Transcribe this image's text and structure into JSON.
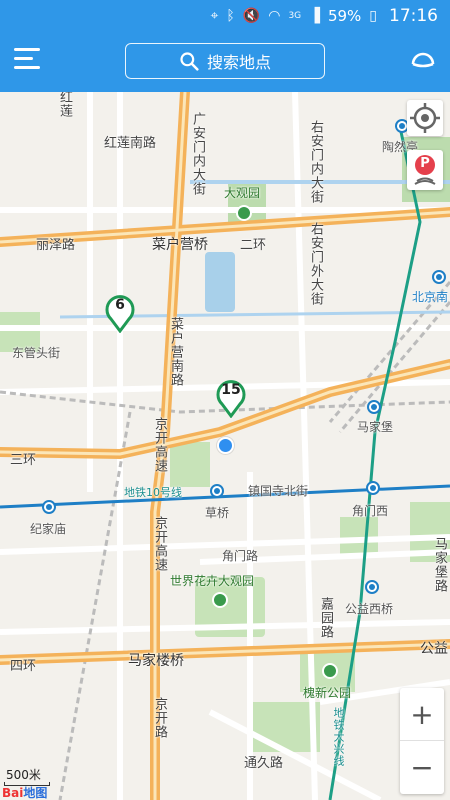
{
  "status_bar": {
    "battery": "59%",
    "time": "17:16",
    "network": "3G",
    "icons": [
      "location-icon",
      "bluetooth-icon",
      "mute-icon",
      "wifi-icon",
      "signal-icon",
      "battery-icon"
    ]
  },
  "header": {
    "search_placeholder": "搜索地点",
    "menu_icon": "menu-icon",
    "user_icon": "user-icon"
  },
  "map": {
    "labels": {
      "hongliannanlu": "红莲南路",
      "hongliannan_v": "红莲",
      "anyuan": "广安门内大街",
      "lizelu": "丽泽路",
      "caihuqiao": "菜户营桥",
      "erhuan": "二环",
      "daguanyuan": "大观园",
      "youanmen_nei": "右安门内大街",
      "youanmen_wai": "右安门外大街",
      "taoranting": "陶然亭",
      "beijingnan": "北京南",
      "dongguantoujie": "东管头街",
      "caihuyingnanlu": "菜户营南路",
      "jingkai_1": "京开高速",
      "jingkai_2": "京开高速",
      "jingkai_3": "京开路",
      "sanhuan": "三环",
      "majiapu": "马家堡",
      "metro10": "地铁10号线",
      "zhenguosibeijie": "镇国寺北街",
      "jiajiamiao": "纪家庙",
      "caoqiao": "草桥",
      "jiaomenxi": "角门西",
      "jiaomenlu": "角门路",
      "shijiehuahui": "世界花卉大观园",
      "majiapulu": "马家堡路",
      "jiayuanlu": "嘉园路",
      "gongyixiqiao": "公益西桥",
      "sihuan": "四环",
      "majialouqiao": "马家楼桥",
      "gongyiqiao": "公益",
      "huaixingongyuan": "槐新公园",
      "metro4": "地铁4号线",
      "tongjiulu": "通久路",
      "metro4_dx": "地铁大兴线"
    },
    "pins": [
      {
        "label": "6"
      },
      {
        "label": "15"
      }
    ],
    "scale": "500米",
    "logo": "Bai",
    "logo_suffix": "地图"
  },
  "controls": {
    "locate_icon": "target-icon",
    "parking_label": "P",
    "zoom_in": "+",
    "zoom_out": "−"
  },
  "colors": {
    "accent": "#2f97e8",
    "highway": "#f4b25a",
    "metro_line": "#1e7fc6",
    "metro_green": "#1c9f86",
    "park": "#b7d9a7",
    "water": "#aed3ef"
  }
}
